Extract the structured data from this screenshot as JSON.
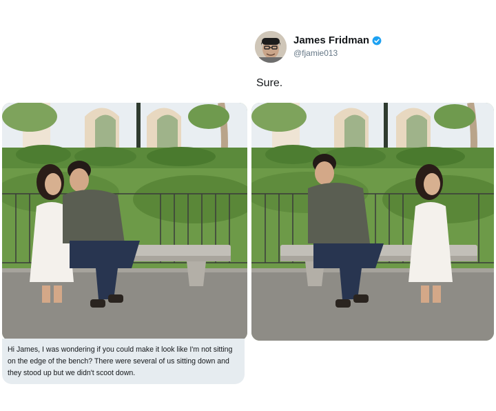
{
  "tweet": {
    "author": {
      "display_name": "James Fridman",
      "handle": "@fjamie013",
      "verified": true,
      "avatar_icon": "avatar-icon"
    },
    "reply_text": "Sure."
  },
  "request_message": {
    "text": "Hi James, I was wondering if you could make it look like I'm not sitting on the edge of the bench? There were several of us sitting down and they stood up but we didn't scoot down."
  },
  "colors": {
    "verified_badge": "#1da1f2",
    "bubble_bg": "#e6ecf0",
    "handle_text": "#657786"
  }
}
